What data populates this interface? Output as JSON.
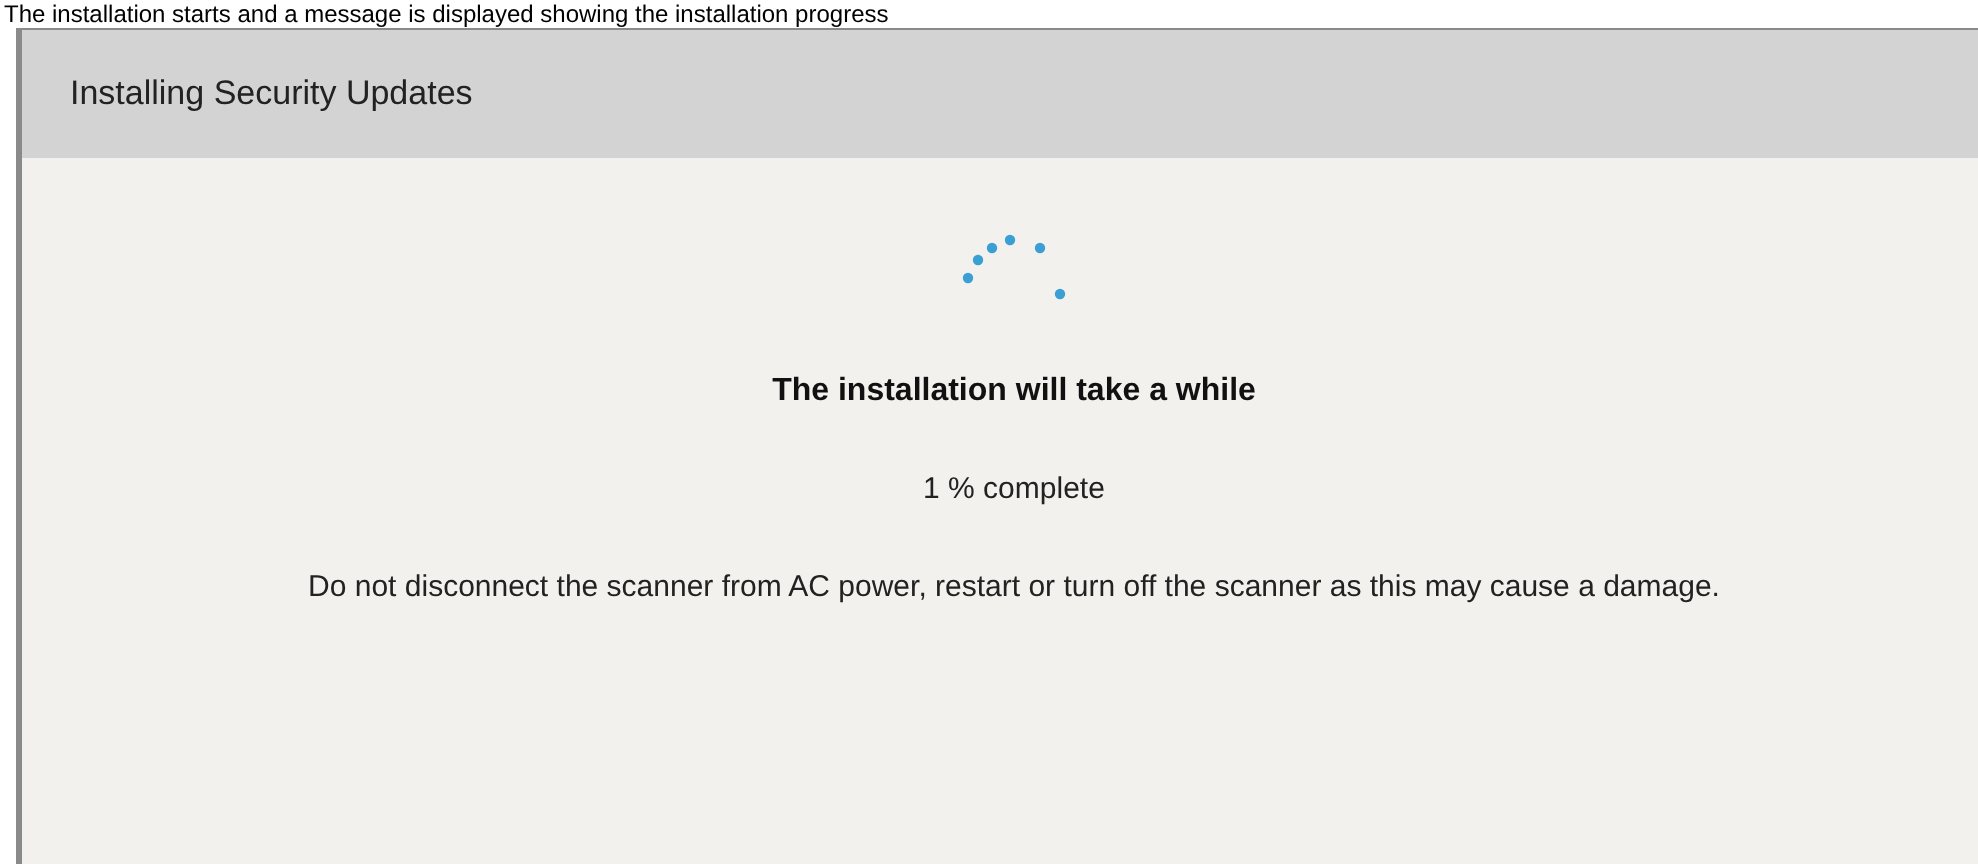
{
  "caption": "The installation starts and a message is displayed showing the installation progress",
  "window": {
    "title": "Installing Security Updates"
  },
  "heading": "The installation will take a while",
  "progress_text": "1 % complete",
  "warning": "Do not disconnect the scanner from AC power, restart or turn off the scanner as this may cause a damage."
}
